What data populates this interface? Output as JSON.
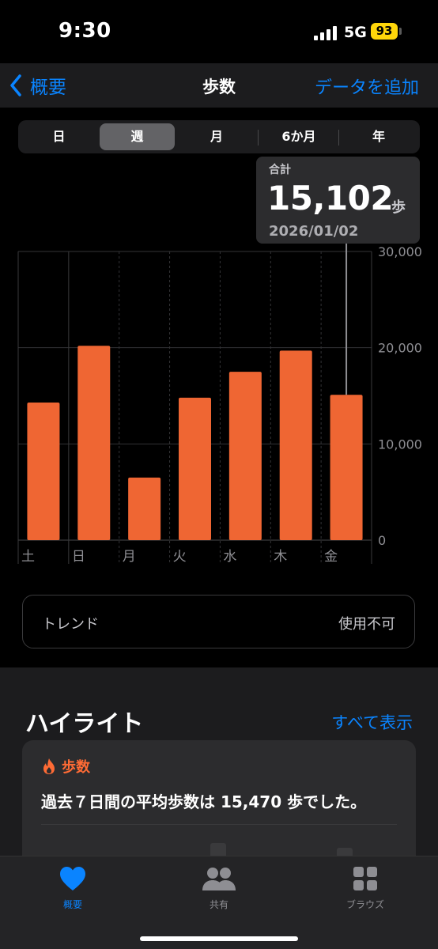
{
  "status_bar": {
    "time": "9:30",
    "network": "5G",
    "battery": "93"
  },
  "nav": {
    "back_label": "概要",
    "title": "歩数",
    "action_label": "データを追加"
  },
  "segments": [
    "日",
    "週",
    "月",
    "6か月",
    "年"
  ],
  "selected_segment": "週",
  "callout": {
    "label": "合計",
    "value": "15,102",
    "unit": "歩",
    "date": "2026/01/02"
  },
  "chart_data": {
    "type": "bar",
    "categories": [
      "土",
      "日",
      "月",
      "火",
      "水",
      "木",
      "金"
    ],
    "values": [
      14300,
      20200,
      6500,
      14800,
      17500,
      19700,
      15102
    ],
    "ylim": [
      0,
      30000
    ],
    "yticks": [
      "0",
      "10,000",
      "20,000",
      "30,000"
    ],
    "bar_color": "#ef6633",
    "selected_index": 6
  },
  "trend": {
    "label": "トレンド",
    "value": "使用不可"
  },
  "highlights": {
    "title": "ハイライト",
    "link_label": "すべて表示",
    "card": {
      "category": "歩数",
      "text": "過去７日間の平均歩数は 15,470 歩でした。"
    }
  },
  "tab_bar": {
    "tabs": [
      "概要",
      "共有",
      "ブラウズ"
    ],
    "active": "概要"
  },
  "colors": {
    "accent": "#0a84ff",
    "activity": "#ff6b35",
    "background": "#000000"
  }
}
